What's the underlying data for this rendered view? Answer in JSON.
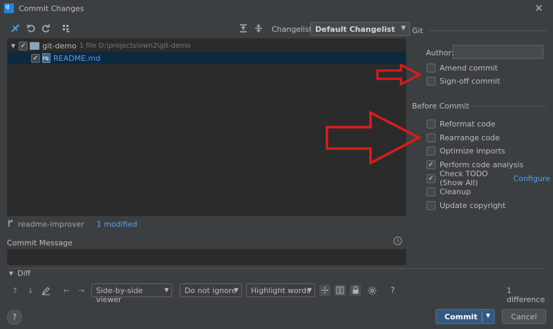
{
  "window": {
    "title": "Commit Changes"
  },
  "toolbar": {
    "changelist_label": "Changelist:",
    "changelist_value": "Default Changelist"
  },
  "tree": {
    "root_label": "git-demo",
    "root_meta": "1 file  D:\\projects\\own2\\git-demo",
    "file_label": "README.md"
  },
  "branch": {
    "name": "readme-improver",
    "modified": "1 modified"
  },
  "commit_message": {
    "label": "Commit Message"
  },
  "diff": {
    "label": "Diff",
    "viewer": "Side-by-side viewer",
    "ignore": "Do not ignore",
    "highlight": "Highlight words",
    "help": "?",
    "difference_count": "1 difference"
  },
  "git": {
    "section_title": "Git",
    "author_label": "Author:",
    "author_value": "",
    "amend": "Amend commit",
    "signoff": "Sign-off commit"
  },
  "before_commit": {
    "section_title": "Before Commit",
    "options": [
      {
        "label": "Reformat code",
        "checked": false
      },
      {
        "label": "Rearrange code",
        "checked": false
      },
      {
        "label": "Optimize imports",
        "checked": false
      },
      {
        "label": "Perform code analysis",
        "checked": true
      },
      {
        "label": "Check TODO (Show All)",
        "checked": true
      },
      {
        "label": "Cleanup",
        "checked": false
      },
      {
        "label": "Update copyright",
        "checked": false
      }
    ],
    "configure_link": "Configure"
  },
  "buttons": {
    "commit": "Commit",
    "cancel": "Cancel",
    "help": "?"
  },
  "colors": {
    "background": "#3c3f41",
    "tree_background": "#2b2b2b",
    "selection": "#0d293e",
    "accent_blue": "#589df6",
    "commit_button": "#365880",
    "annotation_arrow": "#e01b1b"
  }
}
